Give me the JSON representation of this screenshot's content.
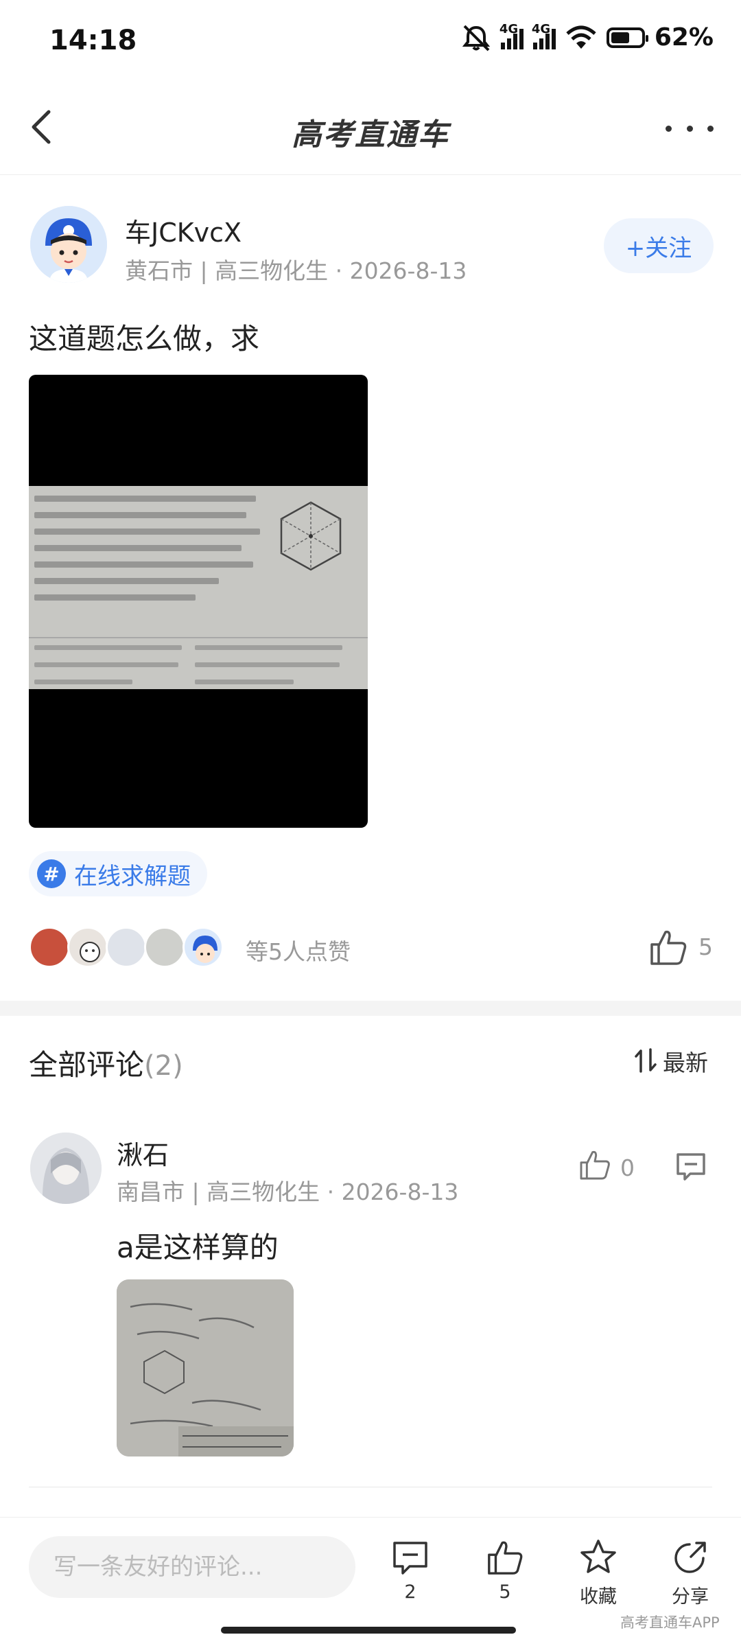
{
  "status_bar": {
    "time": "14:18",
    "network_1": "4G",
    "network_2": "4G",
    "battery": "62%",
    "battery_level": 0.62
  },
  "header": {
    "title": "高考直通车"
  },
  "post": {
    "author_name": "车JCKvcX",
    "author_meta": "黄石市 | 高三物化生 · 2026-8-13",
    "follow_label": "+关注",
    "text": "这道题怎么做，求",
    "topic": "在线求解题",
    "likes_text": "等5人点赞",
    "like_count": "5"
  },
  "comments": {
    "title": "全部评论",
    "count": "(2)",
    "sort_label": "最新",
    "items": [
      {
        "name": "湫石",
        "meta": "南昌市 | 高三物化生 · 2026-8-13",
        "like_count": "0",
        "text": "a是这样算的"
      }
    ]
  },
  "bottom_bar": {
    "input_placeholder": "写一条友好的评论...",
    "comment_count": "2",
    "like_count": "5",
    "favorite_label": "收藏",
    "share_label": "分享",
    "watermark": "高考直通车APP"
  },
  "colors": {
    "accent": "#3a7be8",
    "muted": "#999999",
    "text": "#222222"
  }
}
